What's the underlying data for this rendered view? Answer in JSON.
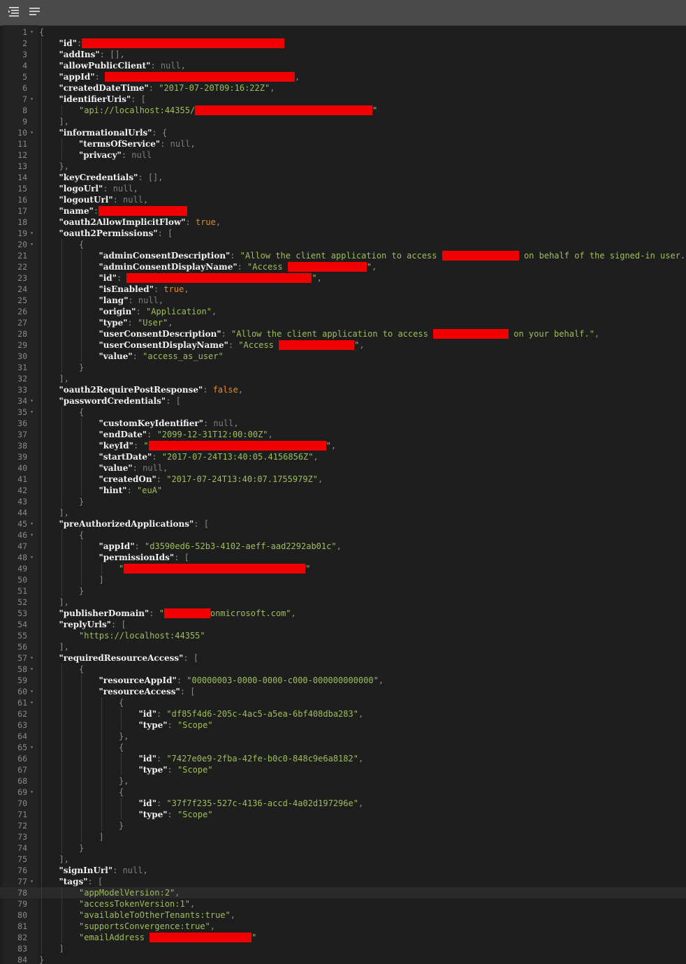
{
  "toolbar": {
    "format_icon": "format-document-icon",
    "wrap_icon": "word-wrap-icon"
  },
  "colors": {
    "key": "#f0f0f0",
    "string": "#9dbf5a",
    "boolean": "#e78a2b",
    "null": "#7d7d7d",
    "redaction": "#f00000"
  },
  "lines": [
    {
      "t": [
        [
          "p",
          "{"
        ]
      ]
    },
    {
      "t": [
        [
          "k",
          "\"id\""
        ],
        [
          "p",
          ":"
        ],
        [
          "r",
          290
        ]
      ]
    },
    {
      "t": [
        [
          "k",
          "\"addIns\""
        ],
        [
          "p",
          ": [],"
        ]
      ]
    },
    {
      "t": [
        [
          "k",
          "\"allowPublicClient\""
        ],
        [
          "p",
          ": "
        ],
        [
          "n",
          "null"
        ],
        [
          "p",
          ","
        ]
      ]
    },
    {
      "t": [
        [
          "k",
          "\"appId\""
        ],
        [
          "p",
          ": "
        ],
        [
          "r",
          272
        ],
        [
          "p",
          ","
        ]
      ]
    },
    {
      "t": [
        [
          "k",
          "\"createdDateTime\""
        ],
        [
          "p",
          ": "
        ],
        [
          "s",
          "\"2017-07-20T09:16:22Z\""
        ],
        [
          "p",
          ","
        ]
      ]
    },
    {
      "t": [
        [
          "k",
          "\"identifierUris\""
        ],
        [
          "p",
          ": ["
        ]
      ]
    },
    {
      "t": [
        [
          "s",
          "\"api://localhost:44355/"
        ],
        [
          "r",
          254
        ],
        [
          "s",
          "\""
        ]
      ]
    },
    {
      "t": [
        [
          "p",
          "],"
        ]
      ]
    },
    {
      "t": [
        [
          "k",
          "\"informationalUrls\""
        ],
        [
          "p",
          ": {"
        ]
      ]
    },
    {
      "t": [
        [
          "k",
          "\"termsOfService\""
        ],
        [
          "p",
          ": "
        ],
        [
          "n",
          "null"
        ],
        [
          "p",
          ","
        ]
      ]
    },
    {
      "t": [
        [
          "k",
          "\"privacy\""
        ],
        [
          "p",
          ": "
        ],
        [
          "n",
          "null"
        ]
      ]
    },
    {
      "t": [
        [
          "p",
          "},"
        ]
      ]
    },
    {
      "t": [
        [
          "k",
          "\"keyCredentials\""
        ],
        [
          "p",
          ": [],"
        ]
      ]
    },
    {
      "t": [
        [
          "k",
          "\"logoUrl\""
        ],
        [
          "p",
          ": "
        ],
        [
          "n",
          "null"
        ],
        [
          "p",
          ","
        ]
      ]
    },
    {
      "t": [
        [
          "k",
          "\"logoutUrl\""
        ],
        [
          "p",
          ": "
        ],
        [
          "n",
          "null"
        ],
        [
          "p",
          ","
        ]
      ]
    },
    {
      "t": [
        [
          "k",
          "\"name\""
        ],
        [
          "p",
          ":"
        ],
        [
          "r",
          127
        ]
      ]
    },
    {
      "t": [
        [
          "k",
          "\"oauth2AllowImplicitFlow\""
        ],
        [
          "p",
          ": "
        ],
        [
          "b",
          "true"
        ],
        [
          "p",
          ","
        ]
      ]
    },
    {
      "t": [
        [
          "k",
          "\"oauth2Permissions\""
        ],
        [
          "p",
          ": ["
        ]
      ]
    },
    {
      "t": [
        [
          "p",
          "{"
        ]
      ]
    },
    {
      "t": [
        [
          "k",
          "\"adminConsentDescription\""
        ],
        [
          "p",
          ": "
        ],
        [
          "s",
          "\"Allow the client application to access "
        ],
        [
          "r",
          110
        ],
        [
          "s",
          " on behalf of the signed-in user.\""
        ],
        [
          "p",
          ","
        ]
      ]
    },
    {
      "t": [
        [
          "k",
          "\"adminConsentDisplayName\""
        ],
        [
          "p",
          ": "
        ],
        [
          "s",
          "\"Access "
        ],
        [
          "r",
          113
        ],
        [
          "s",
          "\""
        ],
        [
          "p",
          ","
        ]
      ]
    },
    {
      "t": [
        [
          "k",
          "\"id\""
        ],
        [
          "p",
          ": "
        ],
        [
          "r",
          265
        ],
        [
          "s",
          "\""
        ],
        [
          "p",
          ","
        ]
      ]
    },
    {
      "t": [
        [
          "k",
          "\"isEnabled\""
        ],
        [
          "p",
          ": "
        ],
        [
          "b",
          "true"
        ],
        [
          "p",
          ","
        ]
      ]
    },
    {
      "t": [
        [
          "k",
          "\"lang\""
        ],
        [
          "p",
          ": "
        ],
        [
          "n",
          "null"
        ],
        [
          "p",
          ","
        ]
      ]
    },
    {
      "t": [
        [
          "k",
          "\"origin\""
        ],
        [
          "p",
          ": "
        ],
        [
          "s",
          "\"Application\""
        ],
        [
          "p",
          ","
        ]
      ]
    },
    {
      "t": [
        [
          "k",
          "\"type\""
        ],
        [
          "p",
          ": "
        ],
        [
          "s",
          "\"User\""
        ],
        [
          "p",
          ","
        ]
      ]
    },
    {
      "t": [
        [
          "k",
          "\"userConsentDescription\""
        ],
        [
          "p",
          ": "
        ],
        [
          "s",
          "\"Allow the client application to access "
        ],
        [
          "r",
          108
        ],
        [
          "s",
          " on your behalf.\""
        ],
        [
          "p",
          ","
        ]
      ]
    },
    {
      "t": [
        [
          "k",
          "\"userConsentDisplayName\""
        ],
        [
          "p",
          ": "
        ],
        [
          "s",
          "\"Access "
        ],
        [
          "r",
          108
        ],
        [
          "s",
          "\""
        ],
        [
          "p",
          ","
        ]
      ]
    },
    {
      "t": [
        [
          "k",
          "\"value\""
        ],
        [
          "p",
          ": "
        ],
        [
          "s",
          "\"access_as_user\""
        ]
      ]
    },
    {
      "t": [
        [
          "p",
          "}"
        ]
      ]
    },
    {
      "t": [
        [
          "p",
          "],"
        ]
      ]
    },
    {
      "t": [
        [
          "k",
          "\"oauth2RequirePostResponse\""
        ],
        [
          "p",
          ": "
        ],
        [
          "b",
          "false"
        ],
        [
          "p",
          ","
        ]
      ]
    },
    {
      "t": [
        [
          "k",
          "\"passwordCredentials\""
        ],
        [
          "p",
          ": ["
        ]
      ]
    },
    {
      "t": [
        [
          "p",
          "{"
        ]
      ]
    },
    {
      "t": [
        [
          "k",
          "\"customKeyIdentifier\""
        ],
        [
          "p",
          ": "
        ],
        [
          "n",
          "null"
        ],
        [
          "p",
          ","
        ]
      ]
    },
    {
      "t": [
        [
          "k",
          "\"endDate\""
        ],
        [
          "p",
          ": "
        ],
        [
          "s",
          "\"2099-12-31T12:00:00Z\""
        ],
        [
          "p",
          ","
        ]
      ]
    },
    {
      "t": [
        [
          "k",
          "\"keyId\""
        ],
        [
          "p",
          ": "
        ],
        [
          "s",
          "\""
        ],
        [
          "r",
          254
        ],
        [
          "s",
          "\""
        ],
        [
          "p",
          ","
        ]
      ]
    },
    {
      "t": [
        [
          "k",
          "\"startDate\""
        ],
        [
          "p",
          ": "
        ],
        [
          "s",
          "\"2017-07-24T13:40:05.4156856Z\""
        ],
        [
          "p",
          ","
        ]
      ]
    },
    {
      "t": [
        [
          "k",
          "\"value\""
        ],
        [
          "p",
          ": "
        ],
        [
          "n",
          "null"
        ],
        [
          "p",
          ","
        ]
      ]
    },
    {
      "t": [
        [
          "k",
          "\"createdOn\""
        ],
        [
          "p",
          ": "
        ],
        [
          "s",
          "\"2017-07-24T13:40:07.1755979Z\""
        ],
        [
          "p",
          ","
        ]
      ]
    },
    {
      "t": [
        [
          "k",
          "\"hint\""
        ],
        [
          "p",
          ": "
        ],
        [
          "s",
          "\"euA\""
        ]
      ]
    },
    {
      "t": [
        [
          "p",
          "}"
        ]
      ]
    },
    {
      "t": [
        [
          "p",
          "],"
        ]
      ]
    },
    {
      "t": [
        [
          "k",
          "\"preAuthorizedApplications\""
        ],
        [
          "p",
          ": ["
        ]
      ]
    },
    {
      "t": [
        [
          "p",
          "{"
        ]
      ]
    },
    {
      "t": [
        [
          "k",
          "\"appId\""
        ],
        [
          "p",
          ": "
        ],
        [
          "s",
          "\"d3590ed6-52b3-4102-aeff-aad2292ab01c\""
        ],
        [
          "p",
          ","
        ]
      ]
    },
    {
      "t": [
        [
          "k",
          "\"permissionIds\""
        ],
        [
          "p",
          ": ["
        ]
      ]
    },
    {
      "t": [
        [
          "s",
          "\""
        ],
        [
          "r",
          260
        ],
        [
          "s",
          "\""
        ]
      ]
    },
    {
      "t": [
        [
          "p",
          "]"
        ]
      ]
    },
    {
      "t": [
        [
          "p",
          "}"
        ]
      ]
    },
    {
      "t": [
        [
          "p",
          "],"
        ]
      ]
    },
    {
      "t": [
        [
          "k",
          "\"publisherDomain\""
        ],
        [
          "p",
          ": "
        ],
        [
          "s",
          "\""
        ],
        [
          "r",
          66
        ],
        [
          "s",
          "onmicrosoft.com\""
        ],
        [
          "p",
          ","
        ]
      ]
    },
    {
      "t": [
        [
          "k",
          "\"replyUrls\""
        ],
        [
          "p",
          ": ["
        ]
      ]
    },
    {
      "t": [
        [
          "s",
          "\"https://localhost:44355\""
        ]
      ]
    },
    {
      "t": [
        [
          "p",
          "],"
        ]
      ]
    },
    {
      "t": [
        [
          "k",
          "\"requiredResourceAccess\""
        ],
        [
          "p",
          ": ["
        ]
      ]
    },
    {
      "t": [
        [
          "p",
          "{"
        ]
      ]
    },
    {
      "t": [
        [
          "k",
          "\"resourceAppId\""
        ],
        [
          "p",
          ": "
        ],
        [
          "s",
          "\"00000003-0000-0000-c000-000000000000\""
        ],
        [
          "p",
          ","
        ]
      ]
    },
    {
      "t": [
        [
          "k",
          "\"resourceAccess\""
        ],
        [
          "p",
          ": ["
        ]
      ]
    },
    {
      "t": [
        [
          "p",
          "{"
        ]
      ]
    },
    {
      "t": [
        [
          "k",
          "\"id\""
        ],
        [
          "p",
          ": "
        ],
        [
          "s",
          "\"df85f4d6-205c-4ac5-a5ea-6bf408dba283\""
        ],
        [
          "p",
          ","
        ]
      ]
    },
    {
      "t": [
        [
          "k",
          "\"type\""
        ],
        [
          "p",
          ": "
        ],
        [
          "s",
          "\"Scope\""
        ]
      ]
    },
    {
      "t": [
        [
          "p",
          "},"
        ]
      ]
    },
    {
      "t": [
        [
          "p",
          "{"
        ]
      ]
    },
    {
      "t": [
        [
          "k",
          "\"id\""
        ],
        [
          "p",
          ": "
        ],
        [
          "s",
          "\"7427e0e9-2fba-42fe-b0c0-848c9e6a8182\""
        ],
        [
          "p",
          ","
        ]
      ]
    },
    {
      "t": [
        [
          "k",
          "\"type\""
        ],
        [
          "p",
          ": "
        ],
        [
          "s",
          "\"Scope\""
        ]
      ]
    },
    {
      "t": [
        [
          "p",
          "},"
        ]
      ]
    },
    {
      "t": [
        [
          "p",
          "{"
        ]
      ]
    },
    {
      "t": [
        [
          "k",
          "\"id\""
        ],
        [
          "p",
          ": "
        ],
        [
          "s",
          "\"37f7f235-527c-4136-accd-4a02d197296e\""
        ],
        [
          "p",
          ","
        ]
      ]
    },
    {
      "t": [
        [
          "k",
          "\"type\""
        ],
        [
          "p",
          ": "
        ],
        [
          "s",
          "\"Scope\""
        ]
      ]
    },
    {
      "t": [
        [
          "p",
          "}"
        ]
      ]
    },
    {
      "t": [
        [
          "p",
          "]"
        ]
      ]
    },
    {
      "t": [
        [
          "p",
          "}"
        ]
      ]
    },
    {
      "t": [
        [
          "p",
          "],"
        ]
      ]
    },
    {
      "t": [
        [
          "k",
          "\"signInUrl\""
        ],
        [
          "p",
          ": "
        ],
        [
          "n",
          "null"
        ],
        [
          "p",
          ","
        ]
      ]
    },
    {
      "t": [
        [
          "k",
          "\"tags\""
        ],
        [
          "p",
          ": ["
        ]
      ]
    },
    {
      "t": [
        [
          "s",
          "\"appModelVersion:2\""
        ],
        [
          "p",
          ","
        ]
      ]
    },
    {
      "t": [
        [
          "s",
          "\"accessTokenVersion:1\""
        ],
        [
          "p",
          ","
        ]
      ]
    },
    {
      "t": [
        [
          "s",
          "\"availableToOtherTenants:true\""
        ],
        [
          "p",
          ","
        ]
      ]
    },
    {
      "t": [
        [
          "s",
          "\"supportsConvergence:true\""
        ],
        [
          "p",
          ","
        ]
      ]
    },
    {
      "t": [
        [
          "s",
          "\"emailAddress "
        ],
        [
          "r",
          146
        ],
        [
          "s",
          "\""
        ]
      ]
    },
    {
      "t": [
        [
          "p",
          "]"
        ]
      ]
    },
    {
      "t": [
        [
          "p",
          "}"
        ]
      ]
    }
  ]
}
